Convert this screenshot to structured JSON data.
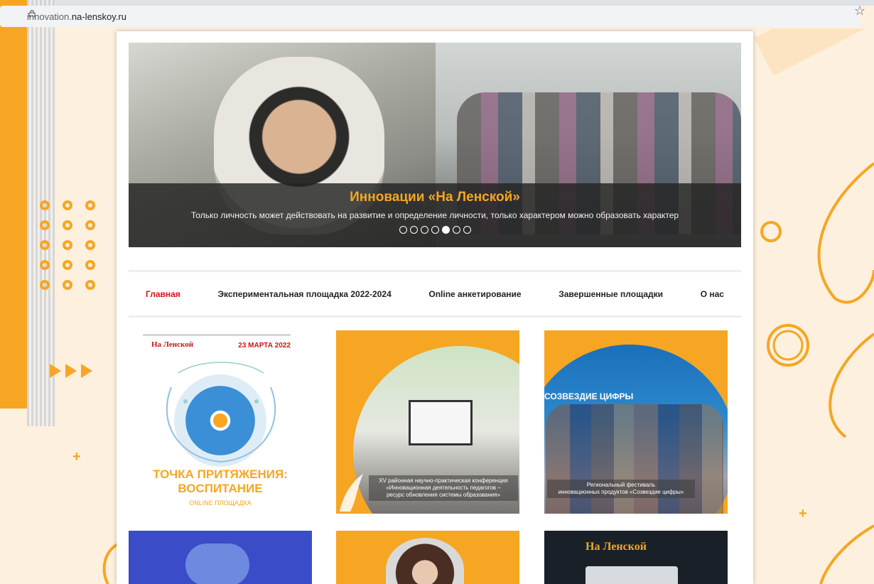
{
  "browser": {
    "url_prefix": "innovation.",
    "url_domain": "na-lenskoy.ru"
  },
  "slider": {
    "title": "Инновации «На Ленской»",
    "text": "Только личность может действовать на развитие и определение личности, только характером можно образовать характер",
    "slide_count": 7,
    "active_slide": 5
  },
  "menu": {
    "items": [
      {
        "label": "Главная",
        "active": true
      },
      {
        "label": "Экспериментальная площадка 2022-2024"
      },
      {
        "label": "Online анкетирование"
      },
      {
        "label": "Завершенные площадки"
      },
      {
        "label": "О нас"
      }
    ]
  },
  "cards": {
    "card1": {
      "logo": "На Ленской",
      "date": "23 МАРТА 2022",
      "title_line1": "ТОЧКА ПРИТЯЖЕНИЯ:",
      "title_line2": "ВОСПИТАНИЕ",
      "subtitle": "ONLINE ПЛОЩАДКА"
    },
    "card2": {
      "caption_line1": "XV районная научно-практическая конференция",
      "caption_line2": "«Инновационная деятельность педагогов –",
      "caption_line3": "ресурс обновления системы образования»"
    },
    "card3": {
      "banner": "СОЗВЕЗДИЕ ЦИФРЫ",
      "caption_line1": "Региональный фестиваль",
      "caption_line2": "инновационных продуктов «Созвездие цифры»"
    },
    "card6": {
      "logo": "На Ленской"
    }
  },
  "colors": {
    "accent": "#f6a623",
    "menu_active": "#d0141a",
    "caption_bg": "#232323"
  }
}
